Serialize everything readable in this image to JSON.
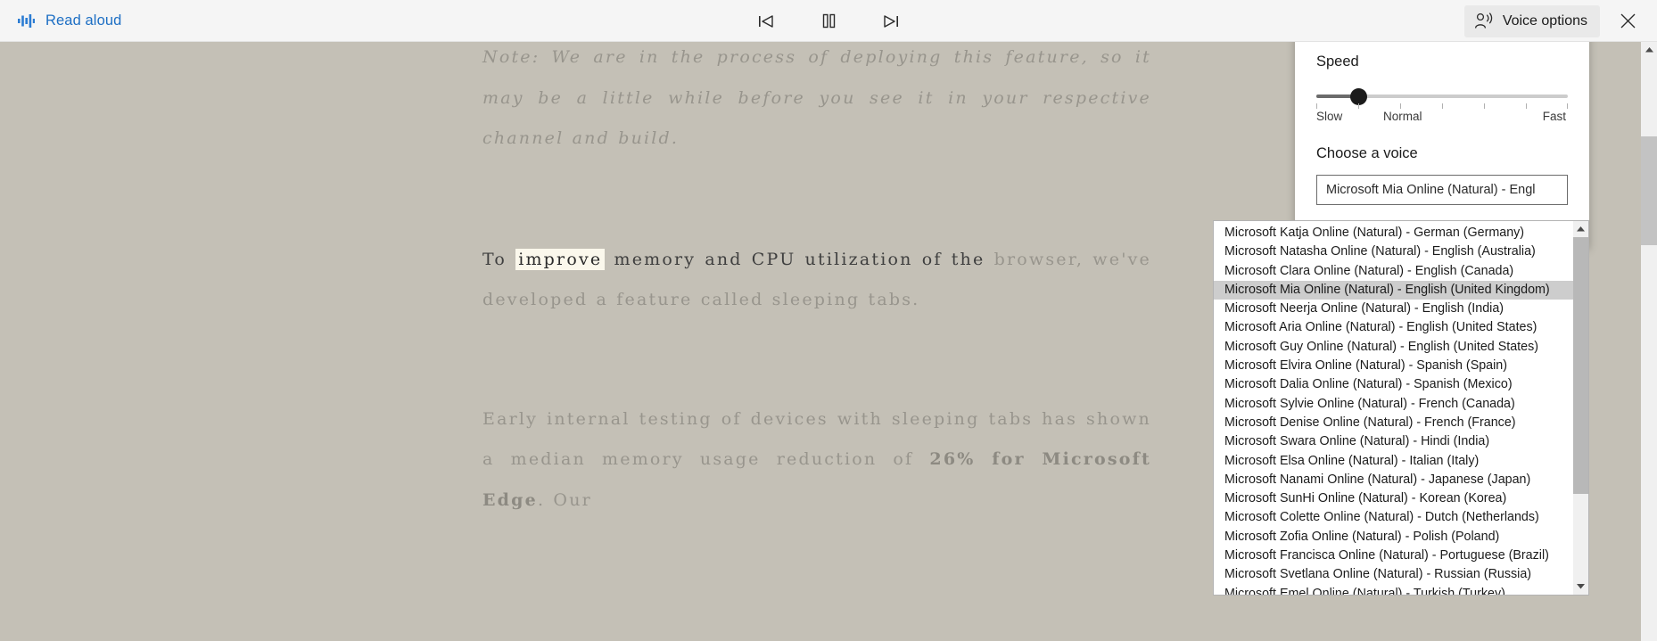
{
  "toolbar": {
    "brand_label": "Read aloud",
    "brand_icon": "waveform-icon",
    "previous_label": "Previous paragraph",
    "pause_label": "Pause",
    "next_label": "Next paragraph",
    "voice_options_label": "Voice options",
    "voice_options_icon": "person-speaking-icon",
    "close_label": "Close",
    "close_icon": "close-icon",
    "accent_color": "#1e6fc4",
    "background_color": "#f5f5f5"
  },
  "article": {
    "paragraph_note": "Note: We are in the process of deploying this feature, so it may be a little while before you see it in your respective channel and build.",
    "paragraph_sleeping_tabs": {
      "read_line_prefix": "To ",
      "highlighted_word": "improve",
      "read_line_suffix": " memory and CPU utilization of the",
      "remainder": "browser, we've developed a feature called sleeping tabs.",
      "highlight_color": "#fbf8ec"
    },
    "paragraph_testing": {
      "before_bold": "Early internal testing of devices with sleeping tabs has shown a median memory usage reduction of ",
      "bold_text": "26% for Microsoft Edge",
      "after_bold": ". Our"
    },
    "text_color": "#98958d",
    "background_color": "#c4c0b6"
  },
  "voice_panel": {
    "speed_heading": "Speed",
    "speed_scale_slow": "Slow",
    "speed_scale_normal": "Normal",
    "speed_scale_fast": "Fast",
    "speed_value_percent": 17,
    "voice_heading": "Choose a voice",
    "selected_voice_display": "Microsoft Mia Online (Natural) - Engl"
  },
  "voice_dropdown": {
    "selected_index": 3,
    "scroll_up_icon": "chevron-up-icon",
    "scroll_down_icon": "chevron-down-icon",
    "items": [
      "Microsoft Katja Online (Natural) - German (Germany)",
      "Microsoft Natasha Online (Natural) - English (Australia)",
      "Microsoft Clara Online (Natural) - English (Canada)",
      "Microsoft Mia Online (Natural) - English (United Kingdom)",
      "Microsoft Neerja Online (Natural) - English (India)",
      "Microsoft Aria Online (Natural) - English (United States)",
      "Microsoft Guy Online (Natural) - English (United States)",
      "Microsoft Elvira Online (Natural) - Spanish (Spain)",
      "Microsoft Dalia Online (Natural) - Spanish (Mexico)",
      "Microsoft Sylvie Online (Natural) - French (Canada)",
      "Microsoft Denise Online (Natural) - French (France)",
      "Microsoft Swara Online (Natural) - Hindi (India)",
      "Microsoft Elsa Online (Natural) - Italian (Italy)",
      "Microsoft Nanami Online (Natural) - Japanese (Japan)",
      "Microsoft SunHi Online (Natural) - Korean (Korea)",
      "Microsoft Colette Online (Natural) - Dutch (Netherlands)",
      "Microsoft Zofia Online (Natural) - Polish (Poland)",
      "Microsoft Francisca Online (Natural) - Portuguese (Brazil)",
      "Microsoft Svetlana Online (Natural) - Russian (Russia)",
      "Microsoft Emel Online (Natural) - Turkish (Turkey)"
    ]
  },
  "page_scrollbar": {
    "up_icon": "chevron-up-icon",
    "down_icon": "chevron-down-icon"
  }
}
